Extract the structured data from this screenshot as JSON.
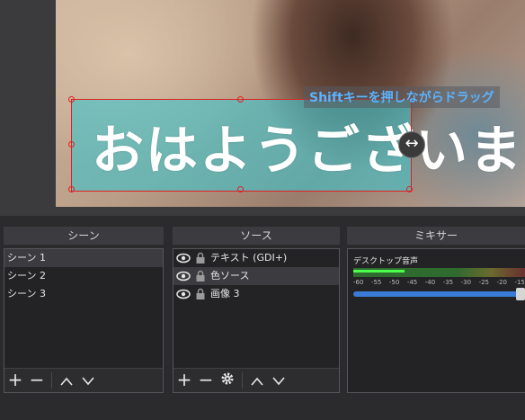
{
  "preview": {
    "overlay_text": "おはようございます",
    "hint": "Shiftキーを押しながらドラッグ"
  },
  "docks": {
    "scenes": {
      "title": "シーン",
      "items": [
        "シーン 1",
        "シーン 2",
        "シーン 3"
      ]
    },
    "sources": {
      "title": "ソース",
      "items": [
        "テキスト (GDI+)",
        "色ソース",
        "画像 3"
      ]
    },
    "mixer": {
      "title": "ミキサー",
      "track_name": "デスクトップ音声",
      "ticks": [
        "-60",
        "-55",
        "-50",
        "-45",
        "-40",
        "-35",
        "-30",
        "-25",
        "-20",
        "-15"
      ],
      "volume_level": 1.0
    }
  },
  "icons": {
    "add": "plus-icon",
    "remove": "minus-icon",
    "up": "chevron-up-icon",
    "down": "chevron-down-icon",
    "settings": "gear-icon",
    "visibility": "eye-icon",
    "lock": "lock-icon",
    "resize": "horizontal-resize-icon"
  },
  "colors": {
    "selection": "#e02020",
    "hint_text": "#5ab4ff",
    "color_source": "#40c4cc",
    "volume_bar": "#3a7bd5"
  }
}
